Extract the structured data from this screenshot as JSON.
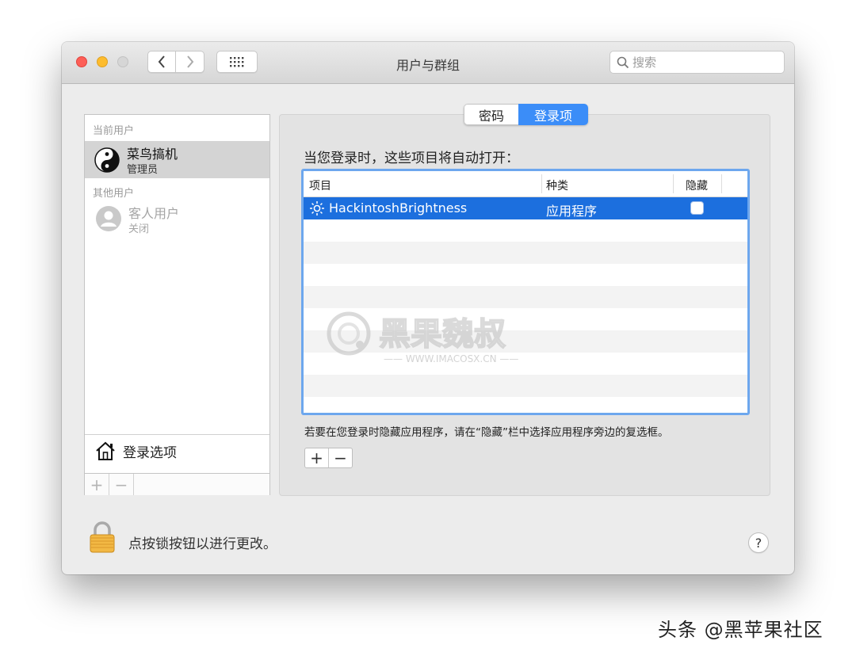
{
  "window": {
    "title": "用户与群组"
  },
  "search": {
    "placeholder": "搜索"
  },
  "sidebar": {
    "current_users_header": "当前用户",
    "current_user": {
      "name": "菜鸟搞机",
      "role": "管理员"
    },
    "other_users_header": "其他用户",
    "other_user": {
      "name": "客人用户",
      "status": "关闭"
    },
    "login_options_label": "登录选项",
    "add_label": "+",
    "remove_label": "−"
  },
  "tabs": [
    {
      "label": "密码",
      "selected": false
    },
    {
      "label": "登录项",
      "selected": true
    }
  ],
  "login_items": {
    "heading": "当您登录时，这些项目将自动打开：",
    "columns": [
      "项目",
      "种类",
      "隐藏"
    ],
    "rows": [
      {
        "item": "HackintoshBrightness",
        "kind": "应用程序",
        "hidden": false,
        "selected": true
      }
    ],
    "hint": "若要在您登录时隐藏应用程序，请在“隐藏”栏中选择应用程序旁边的复选框。",
    "add_label": "+",
    "remove_label": "−"
  },
  "watermark": {
    "title": "黑果魏叔",
    "url": "—— WWW.IMACOSX.CN ——"
  },
  "lock": {
    "text": "点按锁按钮以进行更改。"
  },
  "help": {
    "label": "?"
  },
  "footer": {
    "text": "头条 @黑苹果社区"
  },
  "colors": {
    "accent": "#3b8df8",
    "selection": "#1c6fde",
    "table_focus": "#6da7ee"
  }
}
